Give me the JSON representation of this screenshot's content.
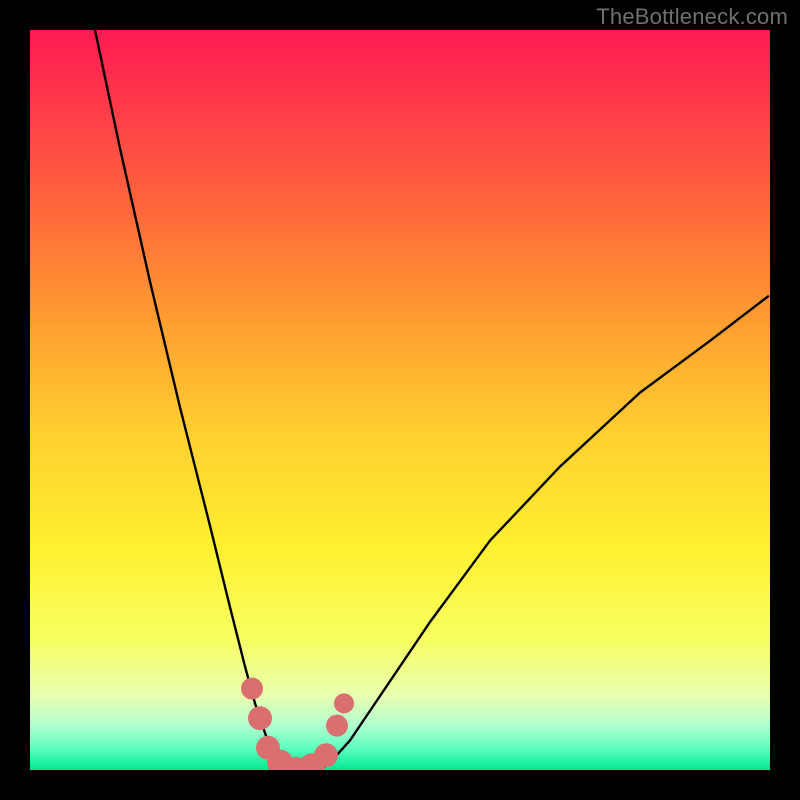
{
  "watermark": {
    "text": "TheBottleneck.com"
  },
  "chart_data": {
    "type": "line",
    "title": "",
    "xlabel": "",
    "ylabel": "",
    "x_range": [
      0,
      740
    ],
    "y_range_percent": [
      0,
      100
    ],
    "series": [
      {
        "name": "left-curve",
        "x": [
          65,
          90,
          120,
          150,
          180,
          200,
          215,
          225,
          235,
          240,
          245,
          250
        ],
        "y_percent": [
          100,
          84,
          66,
          49,
          33,
          22,
          14,
          9,
          5,
          3,
          1,
          0
        ]
      },
      {
        "name": "right-curve",
        "x": [
          290,
          300,
          320,
          350,
          400,
          460,
          530,
          610,
          680,
          738
        ],
        "y_percent": [
          0,
          1,
          4,
          10,
          20,
          31,
          41,
          51,
          58,
          64
        ]
      }
    ],
    "highlight_blobs": {
      "name": "bottom-pink-blobs",
      "color": "#d9706f",
      "points": [
        {
          "x": 222,
          "y_percent": 11,
          "r": 11
        },
        {
          "x": 230,
          "y_percent": 7,
          "r": 12
        },
        {
          "x": 238,
          "y_percent": 3,
          "r": 12
        },
        {
          "x": 250,
          "y_percent": 1,
          "r": 13
        },
        {
          "x": 266,
          "y_percent": 0,
          "r": 13
        },
        {
          "x": 282,
          "y_percent": 0.5,
          "r": 13
        },
        {
          "x": 296,
          "y_percent": 2,
          "r": 12
        },
        {
          "x": 307,
          "y_percent": 6,
          "r": 11
        },
        {
          "x": 314,
          "y_percent": 9,
          "r": 10
        }
      ]
    },
    "gradient_bands_percent": [
      {
        "label": "red",
        "from": 100,
        "to": 70
      },
      {
        "label": "orange",
        "from": 70,
        "to": 45
      },
      {
        "label": "yellow",
        "from": 45,
        "to": 18
      },
      {
        "label": "pale",
        "from": 18,
        "to": 6
      },
      {
        "label": "green",
        "from": 6,
        "to": 0
      }
    ]
  }
}
